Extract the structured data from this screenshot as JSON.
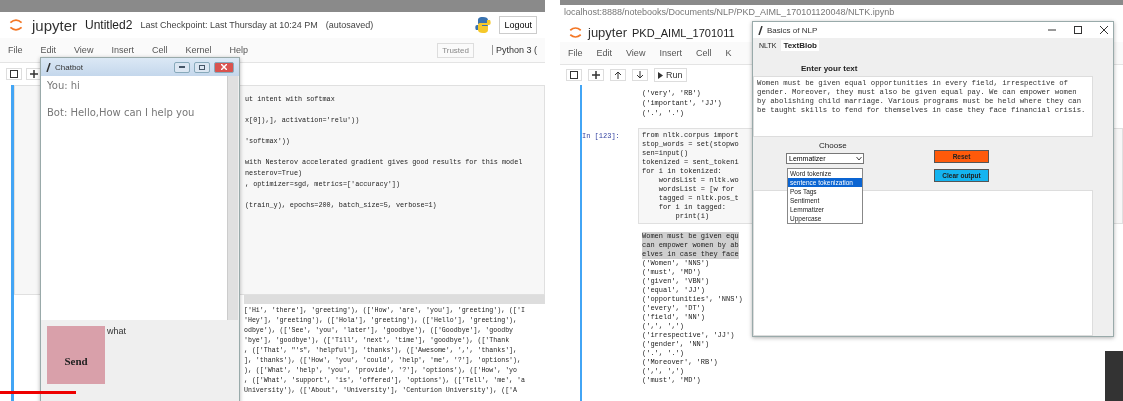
{
  "left": {
    "notebook": {
      "brand": "jupyter",
      "title": "Untitled2",
      "checkpoint": "Last Checkpoint: Last Thursday at 10:24 PM",
      "autosave": "(autosaved)",
      "logout": "Logout",
      "menu": [
        "File",
        "Edit",
        "View",
        "Insert",
        "Cell",
        "Kernel",
        "Help"
      ],
      "trusted": "Trusted",
      "kernel": "Python 3 (",
      "cells": [
        [
          "ut intent with softmax"
        ],
        [
          "x[0]),], activation='relu'))"
        ],
        [
          "'softmax'))"
        ],
        [
          "with Nesterov accelerated gradient gives good results for this model",
          "nesterov=True)",
          ", optimizer=sgd, metrics=['accuracy'])"
        ],
        [
          "(train_y), epochs=200, batch_size=5, verbose=1)"
        ]
      ],
      "output_lines": [
        "['Hi', 'there'], 'greeting'), (['How', 'are', 'you'], 'greeting'), (['I",
        "'Hey'], 'greeting'), (['Hola'], 'greeting'), (['Hello'], 'greeting'),",
        "odbye'), (['See', 'you', 'later'], 'goodbye'), (['Goodbye'], 'goodby",
        "'bye'], 'goodbye'), (['Till', 'next', 'time'], 'goodbye'), (['Thank",
        ", (['That', \"'s\", 'helpful'], 'thanks'), (['Awesome', ',', 'thanks'],",
        "], 'thanks'), (['How', 'you', 'could', 'help', 'me', '?'], 'options'),",
        "), (['What', 'help', 'you', 'provide', '?'], 'options'), (['How', 'yo",
        ", (['What', 'support', 'is', 'offered'], 'options'), (['Tell', 'me', 'a",
        "University'), (['About', 'University'], 'Centurion University'), (['A"
      ]
    },
    "chatbot": {
      "title": "Chatbot",
      "messages": [
        "You: hi",
        "Bot: Hello,How can I help you"
      ],
      "send": "Send",
      "input_value": "what"
    },
    "video_progress": {
      "level": 0.14
    }
  },
  "right": {
    "address": "localhost:8888/notebooks/Documents/NLP/PKD_AIML_170101120048/NLTK.ipynb",
    "notebook": {
      "brand": "jupyter",
      "title": "PKD_AIML_1701011",
      "menu": [
        "File",
        "Edit",
        "View",
        "Insert",
        "Cell",
        "K"
      ],
      "run": "Run",
      "output_top": [
        "('very', 'RB')",
        "('important', 'JJ')",
        "('.', '.')"
      ],
      "prompt": "In [123]:",
      "code_lines": [
        "from nltk.corpus import",
        "stop_words = set(stopwo",
        "sen=input()",
        "tokenized = sent_tokeni",
        "for i in tokenized:",
        "    wordsList = nltk.wo",
        "    wordsList = [w for",
        "    tagged = nltk.pos_t",
        "    for i in tagged:",
        "        print(i)"
      ],
      "highlight_lines": [
        "Women must be given equ",
        "can empower women by ab",
        "elves in case they face"
      ],
      "output_lines": [
        "('Women', 'NNS')",
        "('must', 'MD')",
        "('given', 'VBN')",
        "('equal', 'JJ')",
        "('opportunities', 'NNS')",
        "('every', 'DT')",
        "('field', 'NN')",
        "(',', ',')",
        "('irrespective', 'JJ')",
        "('gender', 'NN')",
        "('.', '.')",
        "('Moreover', 'RB')",
        "(',', ',')",
        "('must', 'MD')"
      ]
    },
    "nlp_window": {
      "title": "Basics of NLP",
      "tabs": [
        {
          "label": "NLTK",
          "selected": false
        },
        {
          "label": "TextBlob",
          "selected": true
        }
      ],
      "prompt_label": "Enter your text",
      "input_text": "Women must be given equal opportunities in every field, irrespective of gender. Moreover, they must also be given equal pay. We can empower women by abolishing child marriage. Various programs must be held where they can be taught skills to fend for themselves in case they face financial crisis.",
      "choose_label": "Choose",
      "combo_value": "Lemmatizer",
      "options": [
        {
          "label": "Word tokenize",
          "selected": false
        },
        {
          "label": "sentence tokenization",
          "selected": true
        },
        {
          "label": "Pos Tags",
          "selected": false
        },
        {
          "label": "Sentiment",
          "selected": false
        },
        {
          "label": "Lemmatizer",
          "selected": false
        },
        {
          "label": "Uppercase",
          "selected": false
        }
      ],
      "buttons": [
        {
          "label": "Reset",
          "color": "#ff5a0a"
        },
        {
          "label": "Clear output",
          "color": "#14b4f0"
        }
      ]
    }
  }
}
